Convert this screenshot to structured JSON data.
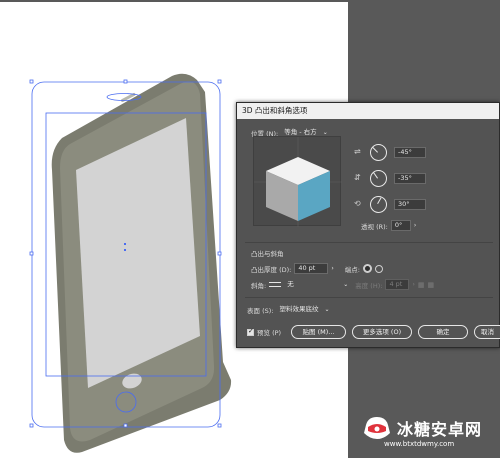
{
  "dialog": {
    "title": "3D 凸出和斜角选项",
    "position_label": "位置 (N):",
    "position_value": "等角 - 右方",
    "angle_x": "-45°",
    "angle_y": "-35°",
    "angle_z": "30°",
    "perspective_label": "透视 (R):",
    "perspective_value": "0°",
    "extrude_section": "凸出与斜角",
    "extrude_depth_label": "凸出厚度 (D):",
    "extrude_depth_value": "40 pt",
    "cap_label": "端点:",
    "bevel_label": "斜角:",
    "bevel_value": "无",
    "height_label": "高度 (H):",
    "height_value": "4 pt",
    "surface_label": "表面 (S):",
    "surface_value": "塑料效果底纹",
    "preview_label": "预览 (P)",
    "map_button": "贴图 (M)...",
    "more_options_button": "更多选项 (O)",
    "ok_button": "确定",
    "cancel_button": "取消"
  },
  "watermark": {
    "text": "冰糖安卓网",
    "url": "www.btxtdwmy.com"
  },
  "colors": {
    "pasteboard": "#595959",
    "dialog_bg": "#535353",
    "cube_front": "#5aa6c3",
    "phone_body": "#8b8c7e",
    "phone_screen": "#d3d3d3",
    "selection": "#4a6cf0"
  },
  "icons": [
    "rotate-x-icon",
    "rotate-y-icon",
    "rotate-z-icon",
    "cap-on-icon",
    "cap-off-icon",
    "bevel-in-icon",
    "bevel-out-icon",
    "dropdown-caret-icon",
    "watermark-logo-icon"
  ]
}
